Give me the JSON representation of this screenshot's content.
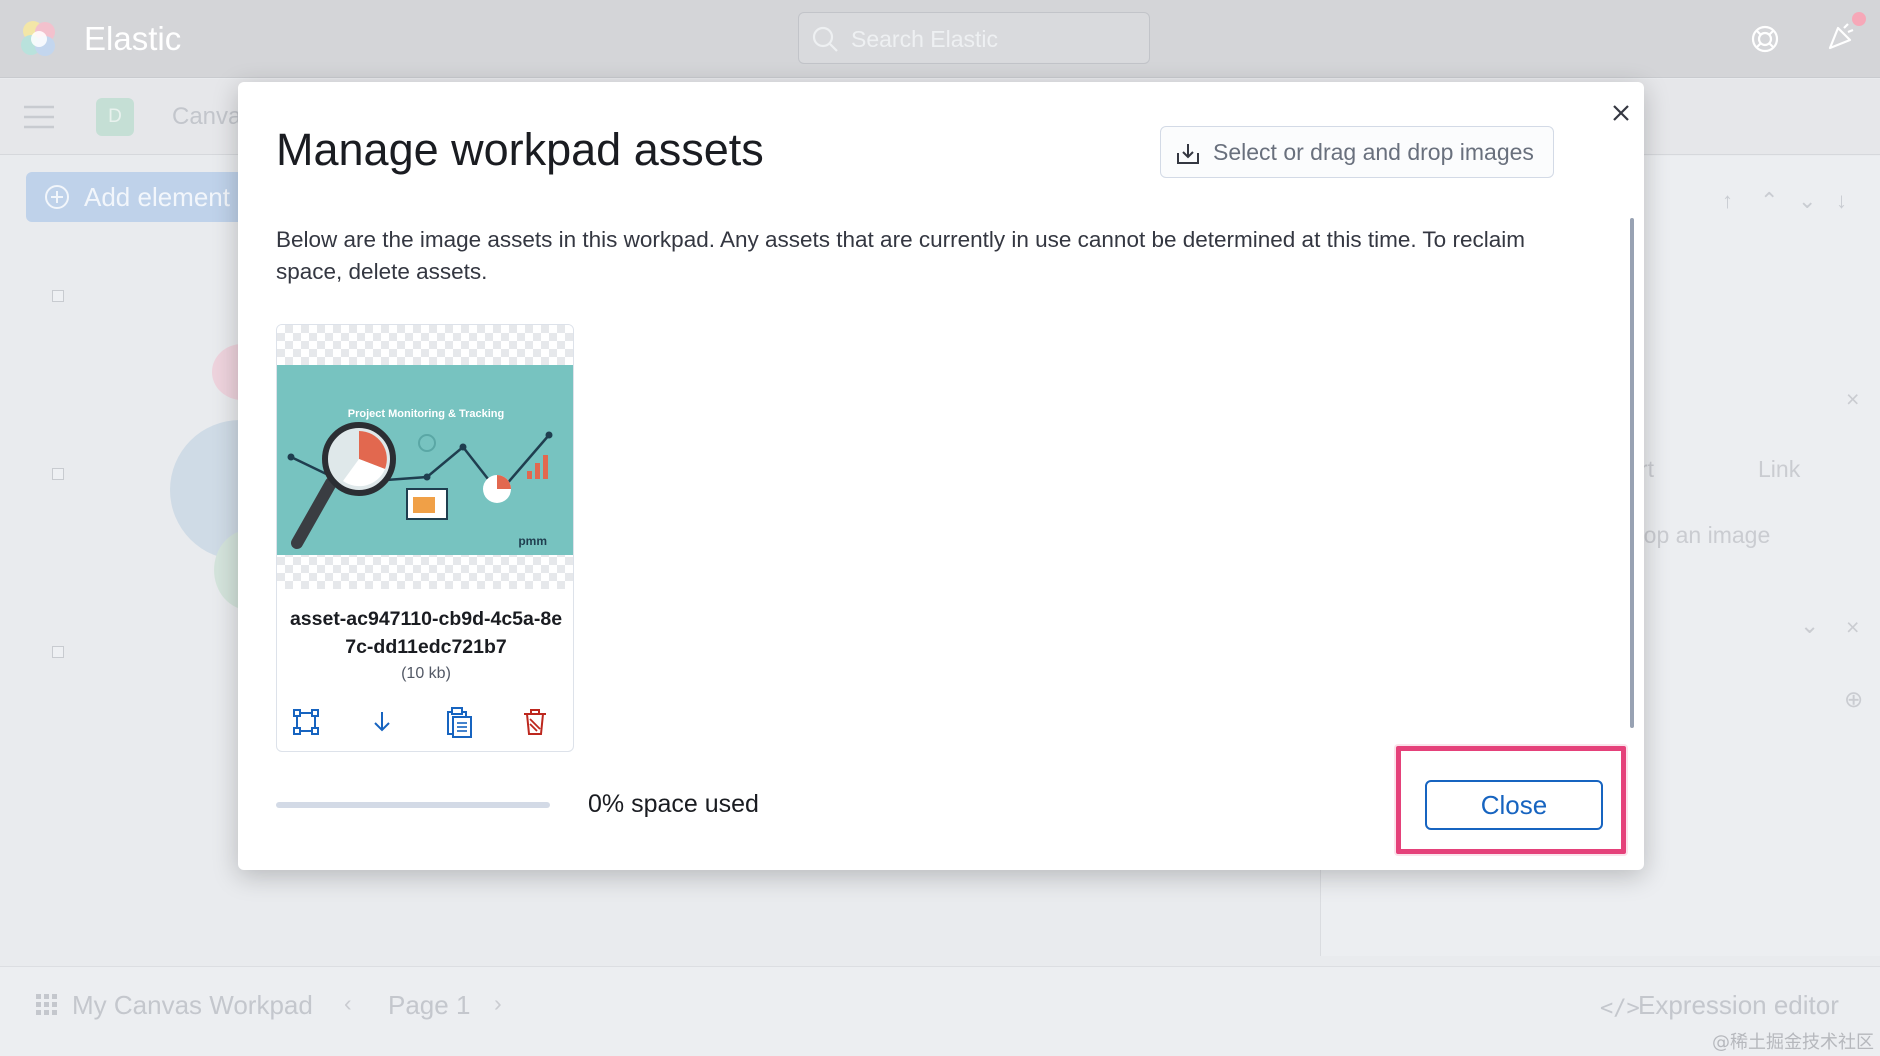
{
  "app": {
    "brand": "Elastic",
    "search_placeholder": "Search Elastic",
    "space_initial": "D",
    "breadcrumb": "Canva",
    "add_element_label": "Add element",
    "right_panel": {
      "tab_partial": "rt",
      "tab_link": "Link",
      "drop_text": "rop an image"
    },
    "workpad_name": "My Canvas Workpad",
    "page_label": "Page 1",
    "expression_editor_label": "Expression editor",
    "watermark": "@稀土掘金技术社区"
  },
  "modal": {
    "title": "Manage workpad assets",
    "upload_label": "Select or drag and drop images",
    "description": "Below are the image assets in this workpad. Any assets that are currently in use cannot be determined at this time. To reclaim space, delete assets.",
    "assets": [
      {
        "name": "asset-ac947110-cb9d-4c5a-8e7c-dd11edc721b7",
        "size": "(10 kb)",
        "thumbnail_title": "Project Monitoring & Tracking",
        "thumbnail_brand": "pmm"
      }
    ],
    "space_used_fraction": 0,
    "space_used_label": "0% space used",
    "close_label": "Close"
  },
  "colors": {
    "accent": "#1764c0",
    "highlight": "#e5417a",
    "danger": "#bd271e",
    "thumbnail_bg": "#77c3c0"
  },
  "icons": {
    "modal_close": "close-icon",
    "upload": "import-icon",
    "asset_actions": [
      "create-image-icon",
      "download-icon",
      "copy-clipboard-icon",
      "trash-icon"
    ]
  }
}
